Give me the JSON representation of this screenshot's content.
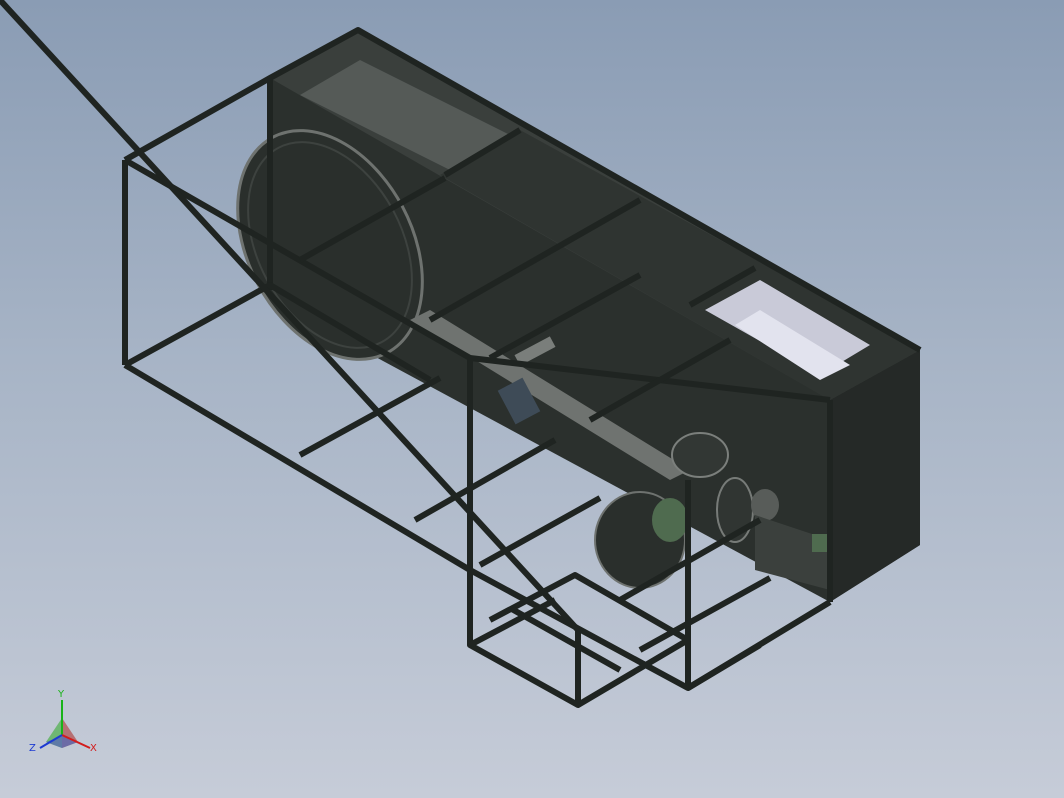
{
  "viewport": {
    "background_top": "#8a9cb4",
    "background_bottom": "#c6ccd8"
  },
  "model": {
    "frame_color": "#1f2421",
    "panel_color": "#2d322f",
    "panel_dark": "#242826",
    "accent_green": "#4f6b4f",
    "light_box": "#c9cad8"
  },
  "triad": {
    "x_label": "X",
    "y_label": "Y",
    "z_label": "Z",
    "x_color": "#d21c1c",
    "y_color": "#19b319",
    "z_color": "#1c3ad2"
  }
}
